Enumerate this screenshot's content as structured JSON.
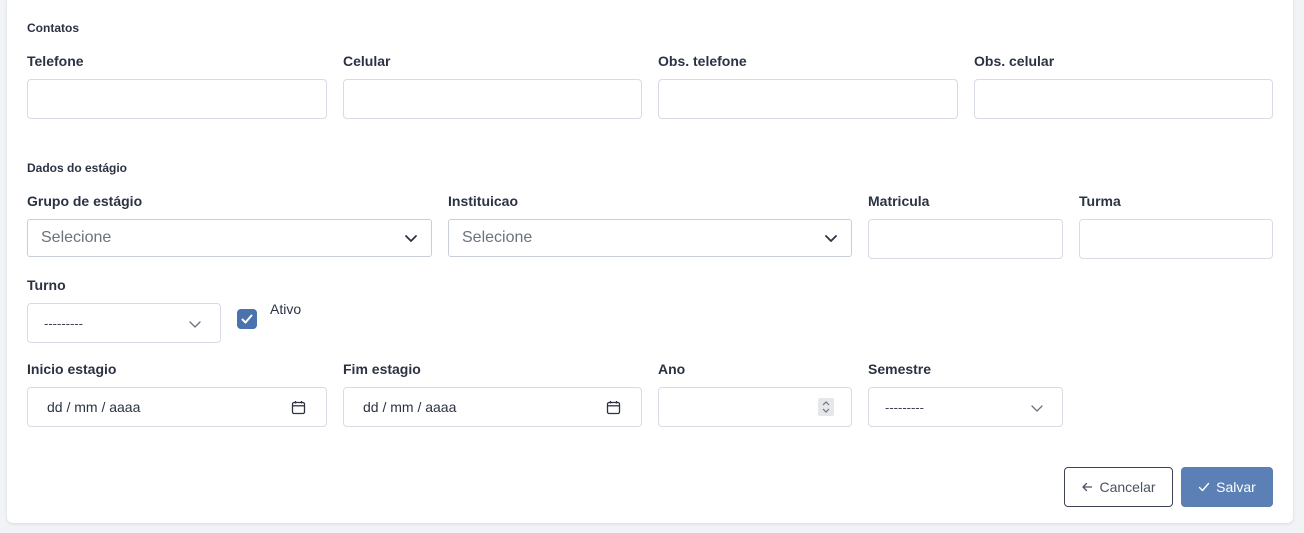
{
  "contatos": {
    "title": "Contatos",
    "telefone_label": "Telefone",
    "celular_label": "Celular",
    "obs_telefone_label": "Obs. telefone",
    "obs_celular_label": "Obs. celular"
  },
  "estagio": {
    "title": "Dados do estágio",
    "grupo_label": "Grupo de estágio",
    "grupo_value": "Selecione",
    "instituicao_label": "Instituicao",
    "instituicao_value": "Selecione",
    "matricula_label": "Matricula",
    "turma_label": "Turma",
    "turno_label": "Turno",
    "turno_value": "---------",
    "ativo_label": "Ativo",
    "ativo_checked": true,
    "inicio_label": "Inicio estagio",
    "inicio_placeholder": "dd / mm / aaaa",
    "fim_label": "Fim estagio",
    "fim_placeholder": "dd / mm / aaaa",
    "ano_label": "Ano",
    "semestre_label": "Semestre",
    "semestre_value": "---------"
  },
  "actions": {
    "cancel_label": "Cancelar",
    "save_label": "Salvar"
  },
  "colors": {
    "primary": "#5b80b5",
    "checkbox": "#4a72ad",
    "background": "#f1f3f7"
  }
}
